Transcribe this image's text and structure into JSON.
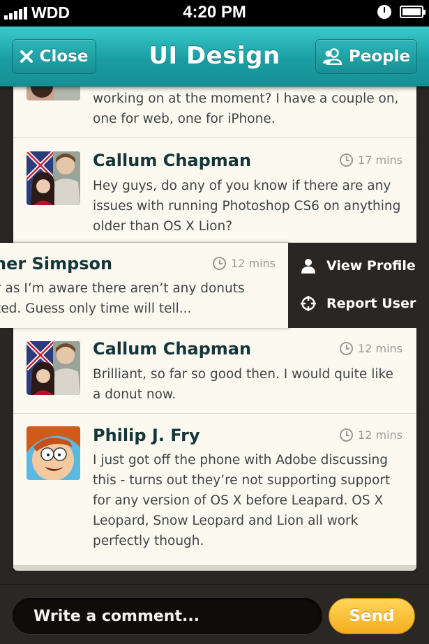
{
  "status_bar": {
    "carrier": "WDD",
    "time": "4:20 PM",
    "battery_level": 1.0
  },
  "nav": {
    "title": "UI Design",
    "close_label": "Close",
    "people_label": "People",
    "close_icon": "close-x-icon",
    "people_icon": "people-icon",
    "accent_color": "#1fa9ae"
  },
  "messages": [
    {
      "name": "",
      "time": "",
      "text_lines": [
        "working on at the moment? I have a couple on,",
        "one for web, one for iPhone."
      ]
    },
    {
      "name": "Callum Chapman",
      "time": "17 mins",
      "text_lines": [
        "Hey guys, do any of you know if there are any",
        "issues with running Photoshop CS6 on anything",
        "older than OS X Lion?"
      ]
    },
    {
      "name": "ner Simpson",
      "time": "12 mins",
      "text_lines": [
        "r as I’m aware there aren’t any donuts",
        "ted. Guess only time will tell..."
      ]
    },
    {
      "name": "Callum Chapman",
      "time": "12 mins",
      "text_lines": [
        "Brilliant, so far so good then. I would quite like",
        "a donut now."
      ]
    },
    {
      "name": "Philip J. Fry",
      "time": "12 mins",
      "text_lines": [
        "I just got off the phone with Adobe discussing",
        "this - turns out they’re not supporting support",
        "for any version of OS X before Leapard. OS X",
        "Leopard, Snow Leopard and Lion all work",
        "perfectly though."
      ]
    }
  ],
  "swipe_actions": {
    "view_profile": "View Profile",
    "report_user": "Report User"
  },
  "comment": {
    "placeholder": "Write a comment...",
    "send_label": "Send",
    "send_color": "#f7b628"
  }
}
